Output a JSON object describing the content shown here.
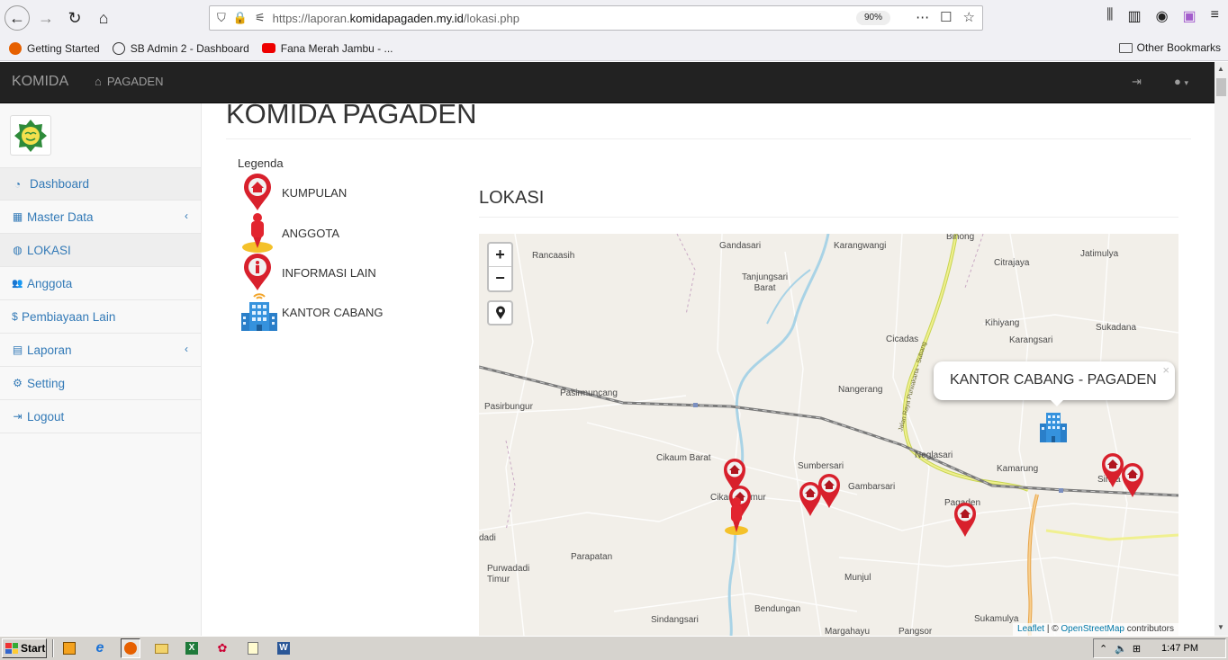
{
  "browser": {
    "url_prefix": "https://laporan.",
    "url_host": "komidapagaden.my.id",
    "url_path": "/lokasi.php",
    "zoom": "90%",
    "bookmarks": [
      "Getting Started",
      "SB Admin 2 - Dashboard",
      "Fana Merah Jambu - ..."
    ],
    "other_bookmarks": "Other Bookmarks"
  },
  "navbar": {
    "brand": "KOMIDA",
    "link": "PAGADEN",
    "user_caret": "▾"
  },
  "sidebar": {
    "items": [
      {
        "label": "Dashboard",
        "icon": "dashboard-icon",
        "glyph": "◔",
        "caret": ""
      },
      {
        "label": "Master Data",
        "icon": "table-icon",
        "glyph": "▦",
        "caret": "‹"
      },
      {
        "label": "LOKASI",
        "icon": "globe-icon",
        "glyph": "◍",
        "caret": ""
      },
      {
        "label": "Anggota",
        "icon": "users-icon",
        "glyph": "👥",
        "caret": ""
      },
      {
        "label": "Pembiayaan Lain",
        "icon": "dollar-icon",
        "glyph": "$",
        "caret": ""
      },
      {
        "label": "Laporan",
        "icon": "file-excel-icon",
        "glyph": "▤",
        "caret": "‹"
      },
      {
        "label": "Setting",
        "icon": "cogs-icon",
        "glyph": "⚙",
        "caret": ""
      },
      {
        "label": "Logout",
        "icon": "sign-out-icon",
        "glyph": "⇥",
        "caret": ""
      }
    ]
  },
  "page": {
    "title": "KOMIDA PAGADEN",
    "legend_title": "Legenda",
    "legend": [
      {
        "label": "KUMPULAN",
        "icon": "kumpulan-marker-icon"
      },
      {
        "label": "ANGGOTA",
        "icon": "anggota-marker-icon"
      },
      {
        "label": "INFORMASI LAIN",
        "icon": "info-marker-icon"
      },
      {
        "label": "KANTOR CABANG",
        "icon": "office-building-icon"
      }
    ],
    "section_title": "LOKASI"
  },
  "map": {
    "zoom_in": "+",
    "zoom_out": "−",
    "popup_text": "KANTOR CABANG - PAGADEN",
    "popup_close": "×",
    "attribution_leaflet": "Leaflet",
    "attribution_sep": " | © ",
    "attribution_osm": "OpenStreetMap",
    "attribution_tail": " contributors",
    "places": [
      "Gandasari",
      "Karangwangi",
      "Binong",
      "Rancaasih",
      "Tanjungsari\nBarat",
      "Citrajaya",
      "Jatimulya",
      "Kihiyang",
      "Karangsari",
      "Sukadana",
      "Cicadas",
      "Pasirmuncang",
      "Pasirbungur",
      "Nangerang",
      "Neglasari",
      "Cikaum Barat",
      "Sumbersari",
      "Gambarsari",
      "Kamarung",
      "Cikaum Timur",
      "Pagaden",
      "Sinda",
      "dadi",
      "Parapatan",
      "Purwadadi\nTimur",
      "Munjul",
      "Sindangsari",
      "Bendungan",
      "Margahayu",
      "Pangsor",
      "Sukamulya"
    ]
  },
  "taskbar": {
    "start": "Start",
    "clock": "1:47 PM"
  }
}
